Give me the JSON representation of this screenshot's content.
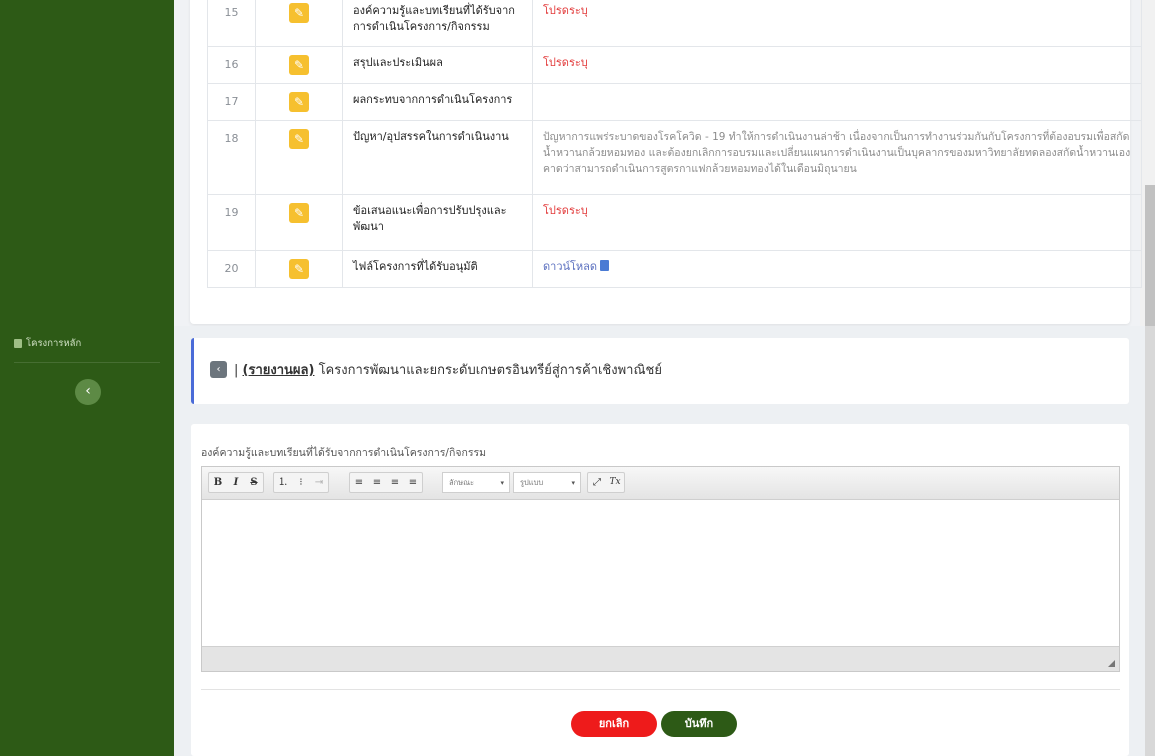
{
  "detail_rows": [
    {
      "no": "15",
      "label": "องค์ความรู้และบทเรียนที่ได้รับจากการดำเนินโครงการ/กิจกรรม",
      "value": "โปรดระบุ",
      "type": "warn"
    },
    {
      "no": "16",
      "label": "สรุปและประเมินผล",
      "value": "โปรดระบุ",
      "type": "warn"
    },
    {
      "no": "17",
      "label": "ผลกระทบจากการดำเนินโครงการ",
      "value": "",
      "type": "empty"
    },
    {
      "no": "18",
      "label": "ปัญหา/อุปสรรคในการดำเนินงาน",
      "value": "ปัญหาการแพร่ระบาดของโรคโควิด - 19 ทำให้การดำเนินงานล่าช้า เนื่องจากเป็นการทำงานร่วมกันกับโครงการที่ต้องอบรมเพื่อสกัดน้ำหวานกล้วยหอมทอง และต้องยกเลิกการอบรมและเปลี่ยนแผนการดำเนินงานเป็นบุคลากรของมหาวิทยาลัยทดลองสกัดน้ำหวานเอง คาดว่าสามารถดำเนินการสูตรกาแฟกล้วยหอมทองได้ในเดือนมิถุนายน",
      "type": "muted"
    },
    {
      "no": "19",
      "label": "ข้อเสนอแนะเพื่อการปรับปรุงและพัฒนา",
      "value": "โปรดระบุ",
      "type": "warn"
    },
    {
      "no": "20",
      "label": "ไฟล์โครงการที่ได้รับอนุมัติ",
      "value": "ดาวน์โหลด",
      "type": "link"
    }
  ],
  "sidebar": {
    "item_label": "โครงการหลัก",
    "toggle_glyph": "‹"
  },
  "header": {
    "back_glyph": "‹",
    "separator": "|",
    "tag": "(รายงานผล)",
    "project_title": " โครงการพัฒนาและยกระดับเกษตรอินทรีย์สู่การค้าเชิงพาณิชย์"
  },
  "form": {
    "field_label": "องค์ความรู้และบทเรียนที่ได้รับจากการดำเนินโครงการ/กิจกรรม",
    "editor_value": "",
    "toolbar": {
      "bold": "B",
      "italic": "I",
      "strike": "S",
      "ordered_list": "⒈",
      "bullet_list": "⁝",
      "indent": "⇥",
      "align_left": "≡",
      "align_center": "≡",
      "align_right": "≡",
      "justify": "≡",
      "font_select": "ลักษณะ",
      "format_select": "รูปแบบ",
      "maximize": "⤢",
      "clear_format": "Tx"
    },
    "cancel_label": "ยกเลิก",
    "save_label": "บันทึก"
  },
  "colors": {
    "sidebar": "#2d5a16",
    "accent": "#4a6bd8",
    "warn": "#e23a3a",
    "edit": "#f6c02f",
    "cancel": "#ee1b1b",
    "save": "#2d5a16"
  },
  "icons": {
    "edit": "pencil-icon",
    "download": "file-download-icon",
    "back": "chevron-left-icon",
    "sidebar_doc": "document-icon"
  }
}
